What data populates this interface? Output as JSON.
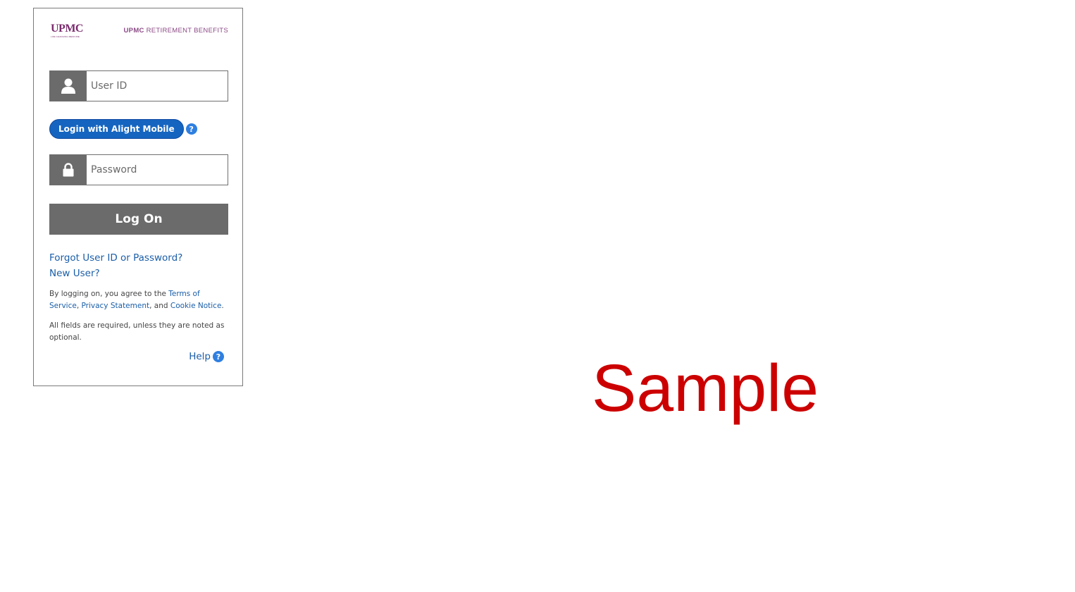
{
  "branding": {
    "logo_text": "UPMC",
    "logo_tagline": "LIFE CHANGING MEDICINE",
    "site_name_bold": "UPMC",
    "site_name_rest": " RETIREMENT BENEFITS",
    "brand_color": "#7b2c6e"
  },
  "login": {
    "user_id_placeholder": "User ID",
    "user_icon": "person-icon",
    "alight_button_label": "Login with Alight Mobile",
    "alight_help_glyph": "?",
    "password_placeholder": "Password",
    "password_icon": "lock-icon",
    "logon_label": "Log On",
    "button_color": "#6b6b6b",
    "alight_color": "#1565c0"
  },
  "links": {
    "forgot": "Forgot User ID or Password?",
    "new_user": "New User?"
  },
  "legal": {
    "prefix": "By logging on, you agree to the ",
    "terms": "Terms of Service",
    "comma": ",",
    "privacy": "Privacy Statement",
    "and": ", and ",
    "cookie": "Cookie Notice",
    "period": "."
  },
  "required_note": "All fields are required, unless they are noted as optional.",
  "help": {
    "label": "Help",
    "glyph": "?"
  },
  "watermark": {
    "text": "Sample",
    "color": "#cc0000"
  }
}
